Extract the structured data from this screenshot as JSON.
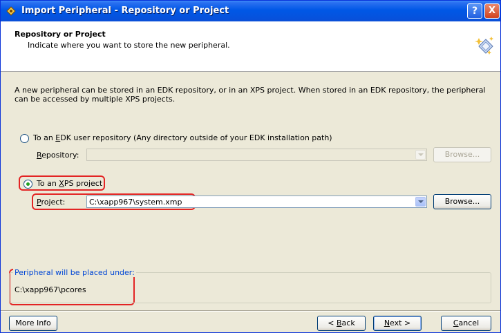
{
  "window": {
    "title": "Import Peripheral - Repository or Project",
    "help_glyph": "?",
    "close_glyph": "X"
  },
  "header": {
    "title": "Repository or Project",
    "subtitle": "Indicate where you want to store the new peripheral."
  },
  "intro": "A new peripheral can be stored in an EDK repository, or in an XPS project. When stored in an EDK repository, the peripheral can be accessed by multiple XPS projects.",
  "option_repo": {
    "label_prefix": "To an ",
    "label_underline": "E",
    "label_rest": "DK user repository (Any directory outside of your EDK installation path)",
    "selected": false,
    "field_label_underline": "R",
    "field_label_rest": "epository:",
    "field_value": "",
    "browse_label": "Browse..."
  },
  "option_xps": {
    "label_prefix": "To an ",
    "label_underline": "X",
    "label_rest": "PS project",
    "selected": true,
    "field_label_underline": "P",
    "field_label_rest": "roject:",
    "field_value": "C:\\xapp967\\system.xmp",
    "browse_label": "Browse..."
  },
  "placement": {
    "legend": "Peripheral will be placed under:",
    "value": "C:\\xapp967\\pcores"
  },
  "footer": {
    "more_info": "More Info",
    "back_underline": "B",
    "back_rest": "ack",
    "back_prefix": "< ",
    "next_underline": "N",
    "next_rest": "ext >",
    "cancel_underline": "C",
    "cancel_rest": "ancel"
  },
  "colors": {
    "highlight": "#e32424",
    "titlebar": "#0058e6",
    "legend": "#0046d5"
  },
  "icons": [
    "xps-app-icon",
    "help-icon",
    "close-icon",
    "peripheral-wizard-icon",
    "chevron-down-icon"
  ]
}
